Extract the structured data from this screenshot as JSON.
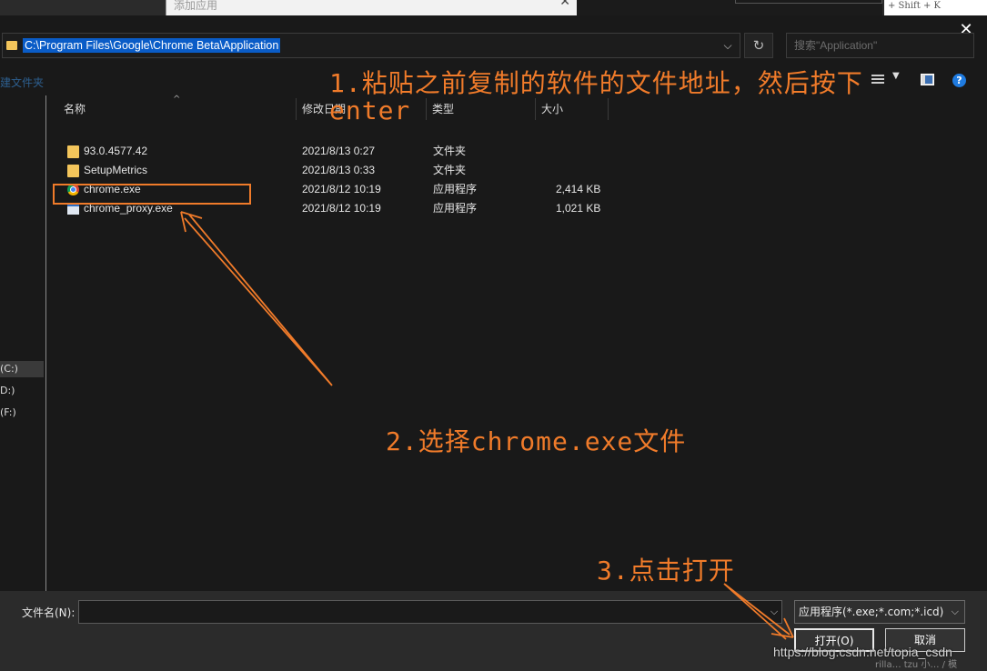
{
  "background": {
    "window_title": "添加应用",
    "close_glyph": "✕",
    "hint_text": "+ Shift + K"
  },
  "dialog": {
    "close_glyph": "✕",
    "address_path": "C:\\Program Files\\Google\\Chrome Beta\\Application",
    "chevron": "⌵",
    "refresh_glyph": "↻",
    "search_placeholder": "搜索\"Application\"",
    "new_folder": "建文件夹",
    "help": "?"
  },
  "nav": {
    "drives": [
      "(C:)",
      "D:)",
      "(F:)"
    ]
  },
  "columns": {
    "name": "名称",
    "date": "修改日期",
    "type": "类型",
    "size": "大小",
    "sort_caret": "^"
  },
  "files": [
    {
      "name": "93.0.4577.42",
      "date": "2021/8/13 0:27",
      "type": "文件夹",
      "size": "",
      "icon": "folder-icon"
    },
    {
      "name": "SetupMetrics",
      "date": "2021/8/13 0:33",
      "type": "文件夹",
      "size": "",
      "icon": "folder-icon"
    },
    {
      "name": "chrome.exe",
      "date": "2021/8/12 10:19",
      "type": "应用程序",
      "size": "2,414 KB",
      "icon": "chrome-icon"
    },
    {
      "name": "chrome_proxy.exe",
      "date": "2021/8/12 10:19",
      "type": "应用程序",
      "size": "1,021 KB",
      "icon": "app-icon"
    }
  ],
  "bottom": {
    "filename_label": "文件名(N):",
    "filename_value": "",
    "filter_value": "应用程序(*.exe;*.com;*.icd)",
    "open_label": "打开(O)",
    "cancel_label": "取消"
  },
  "annotations": {
    "step1_line1": "1.粘贴之前复制的软件的文件地址，然后按下",
    "step1_line2": "enter",
    "step2": "2.选择chrome.exe文件",
    "step3": "3.点击打开",
    "color": "#f07b2a"
  },
  "watermark": {
    "text": "https://blog.csdn.net/topia_csdn",
    "sub": "rilla… tzu 小… / 模"
  }
}
